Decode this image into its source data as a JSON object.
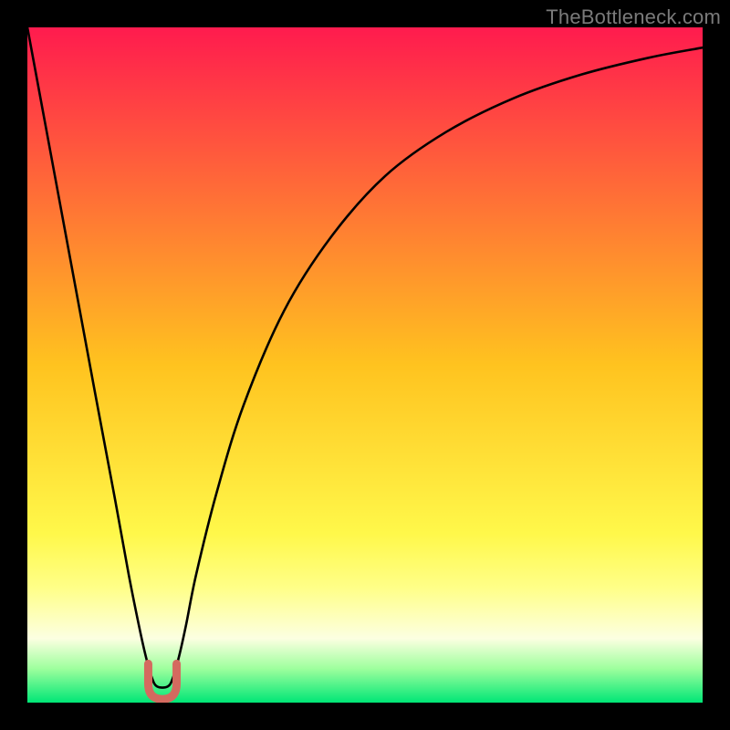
{
  "watermark": "TheBottleneck.com",
  "chart_data": {
    "type": "line",
    "title": "",
    "xlabel": "",
    "ylabel": "",
    "xlim": [
      0,
      100
    ],
    "ylim": [
      0,
      100
    ],
    "grid": false,
    "legend": false,
    "background_gradient": {
      "stops": [
        {
          "offset": 0.0,
          "color": "#ff1b4e"
        },
        {
          "offset": 0.5,
          "color": "#ffc31f"
        },
        {
          "offset": 0.75,
          "color": "#fff84a"
        },
        {
          "offset": 0.83,
          "color": "#ffff88"
        },
        {
          "offset": 0.905,
          "color": "#fcffe1"
        },
        {
          "offset": 0.95,
          "color": "#9dff9d"
        },
        {
          "offset": 1.0,
          "color": "#00e676"
        }
      ]
    },
    "series": [
      {
        "name": "bottleneck-curve",
        "x": [
          0,
          5,
          10,
          13,
          15,
          16.5,
          17.5,
          18.4,
          19.2,
          20.8,
          21.6,
          22.5,
          23.5,
          25,
          28,
          32,
          38,
          45,
          53,
          62,
          72,
          82,
          92,
          100
        ],
        "values": [
          100,
          73,
          46,
          30,
          19,
          11.5,
          7.0,
          3.8,
          2.4,
          2.4,
          3.8,
          7.0,
          11.5,
          19,
          31,
          44,
          58,
          69,
          78,
          84.5,
          89.5,
          93,
          95.5,
          97
        ]
      }
    ],
    "markers": [
      {
        "name": "minimum-marker",
        "shape": "U",
        "x": 20,
        "y": 2.4,
        "color": "#d46a5f",
        "size": 4.2
      }
    ]
  }
}
